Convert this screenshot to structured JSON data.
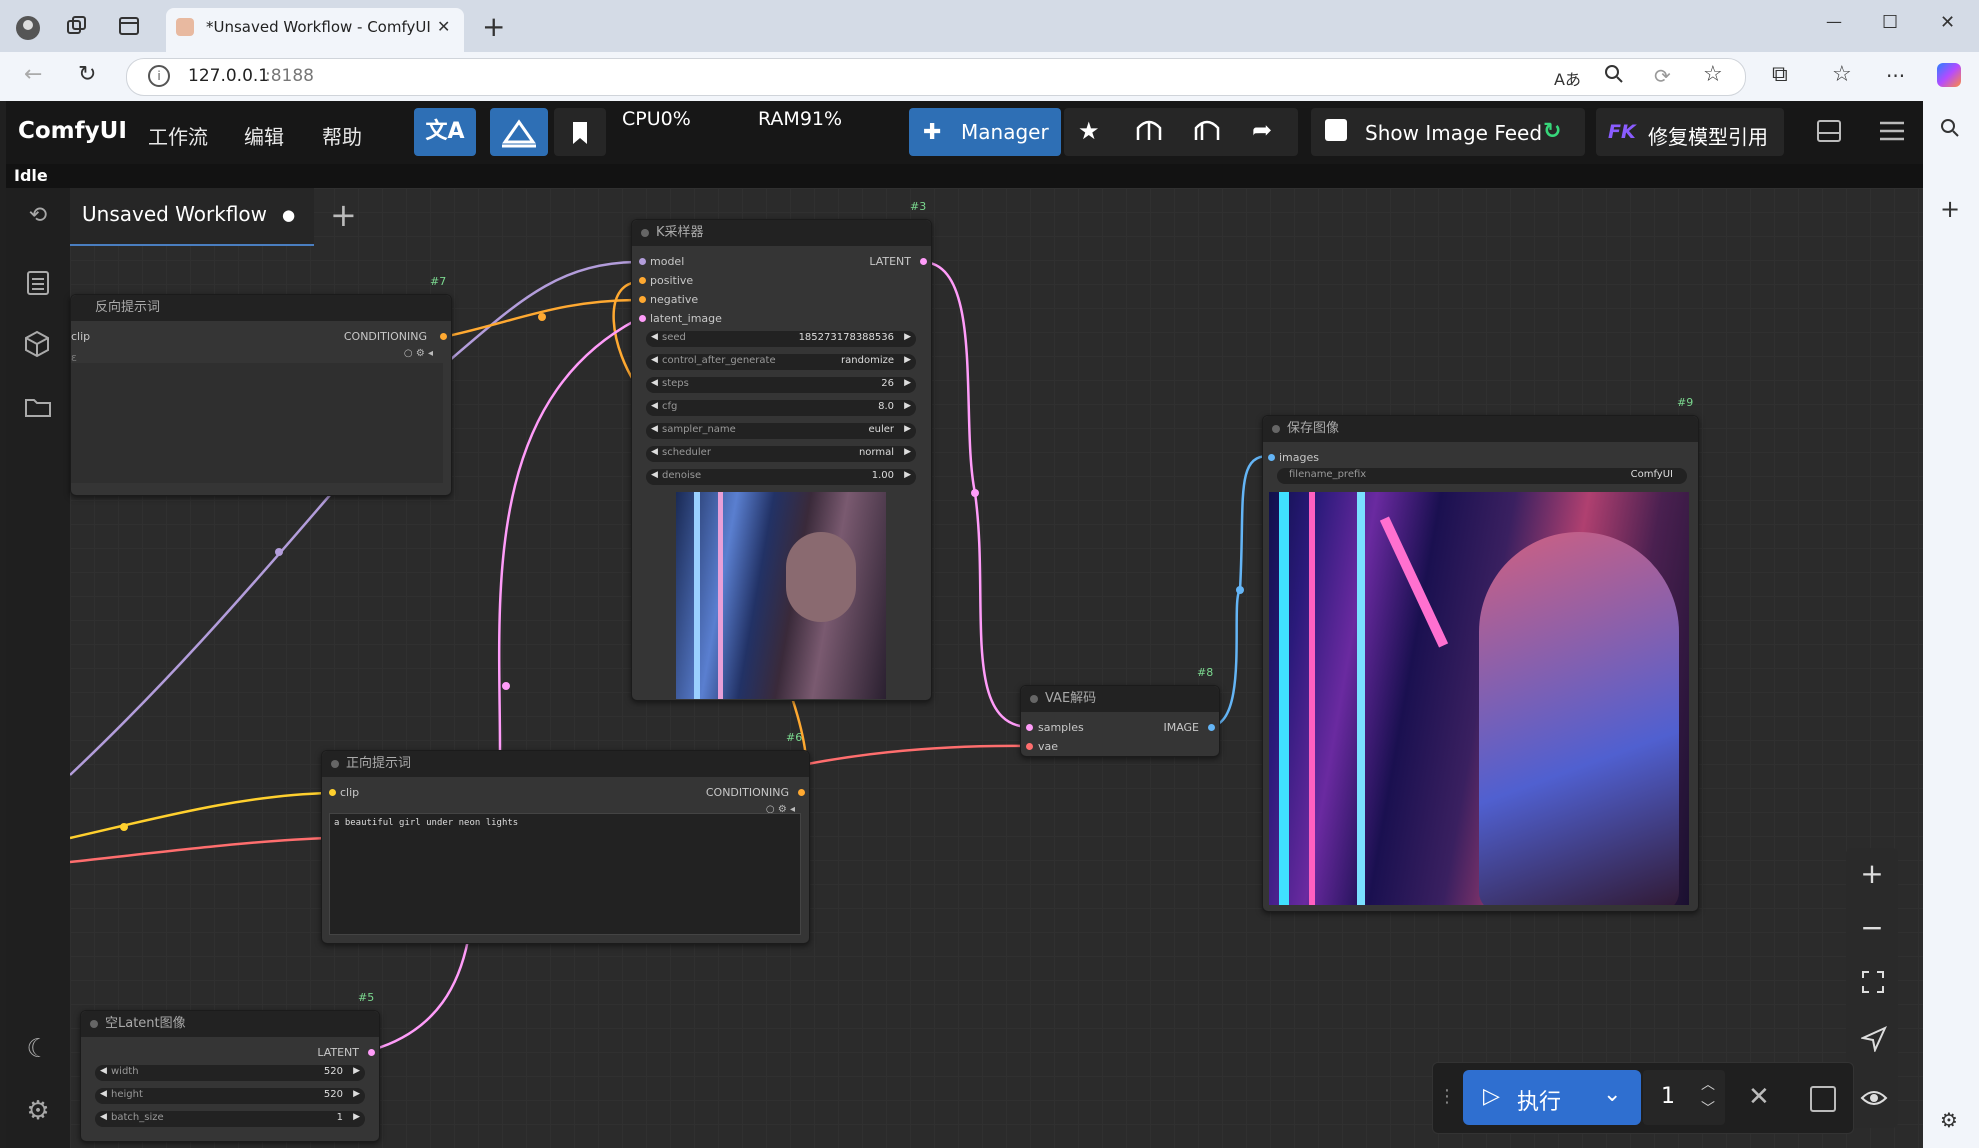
{
  "browser": {
    "tab_title": "*Unsaved Workflow - ComfyUI",
    "tab_close": "✕",
    "new_tab": "+",
    "url": "127.0.0.1",
    "url_port": ":8188",
    "win_min": "—",
    "win_max": "☐",
    "win_close": "✕",
    "read_aloud": "Aあ",
    "more": "···"
  },
  "menubar": {
    "logo": "ComfyUI",
    "menus": [
      "工作流",
      "编辑",
      "帮助"
    ],
    "cpu": "CPU0%",
    "ram": "RAM91%",
    "manager_label": "Manager",
    "image_feed_label": "Show Image Feed",
    "fk_badge": "FK",
    "fix_model_label": "修复模型引用"
  },
  "status": {
    "text": "Idle"
  },
  "workflow_tab": {
    "label": "Unsaved Workflow",
    "dot": "●",
    "add": "+"
  },
  "nodes": {
    "n7": {
      "id": "#7",
      "title": "反向提示词",
      "in_clip": "clip",
      "out": "CONDITIONING",
      "text_stub": "ε"
    },
    "n3": {
      "id": "#3",
      "title": "K采样器",
      "inputs": [
        "model",
        "positive",
        "negative",
        "latent_image"
      ],
      "output": "LATENT",
      "widgets": [
        {
          "label": "seed",
          "value": "185273178388536"
        },
        {
          "label": "control_after_generate",
          "value": "randomize"
        },
        {
          "label": "steps",
          "value": "26"
        },
        {
          "label": "cfg",
          "value": "8.0"
        },
        {
          "label": "sampler_name",
          "value": "euler"
        },
        {
          "label": "scheduler",
          "value": "normal"
        },
        {
          "label": "denoise",
          "value": "1.00"
        }
      ]
    },
    "n9": {
      "id": "#9",
      "title": "保存图像",
      "input": "images",
      "widget_label": "filename_prefix",
      "widget_value": "ComfyUI"
    },
    "n8": {
      "id": "#8",
      "title": "VAE解码",
      "in_samples": "samples",
      "in_vae": "vae",
      "out": "IMAGE"
    },
    "n6": {
      "id": "#6",
      "title": "正向提示词",
      "in_clip": "clip",
      "out": "CONDITIONING",
      "prompt": "a beautiful girl under neon lights"
    },
    "n5": {
      "id": "#5",
      "title": "空Latent图像",
      "out": "LATENT",
      "widgets": [
        {
          "label": "width",
          "value": "520"
        },
        {
          "label": "height",
          "value": "520"
        },
        {
          "label": "batch_size",
          "value": "1"
        }
      ]
    }
  },
  "queue": {
    "run_label": "执行",
    "count": "1"
  },
  "colors": {
    "accent_blue": "#2e6fb5",
    "link_model": "#b39ddb",
    "link_conditioning": "#ffa931",
    "link_latent": "#ff9cf9",
    "link_vae": "#ff6e6e",
    "link_image": "#64b5f6"
  }
}
